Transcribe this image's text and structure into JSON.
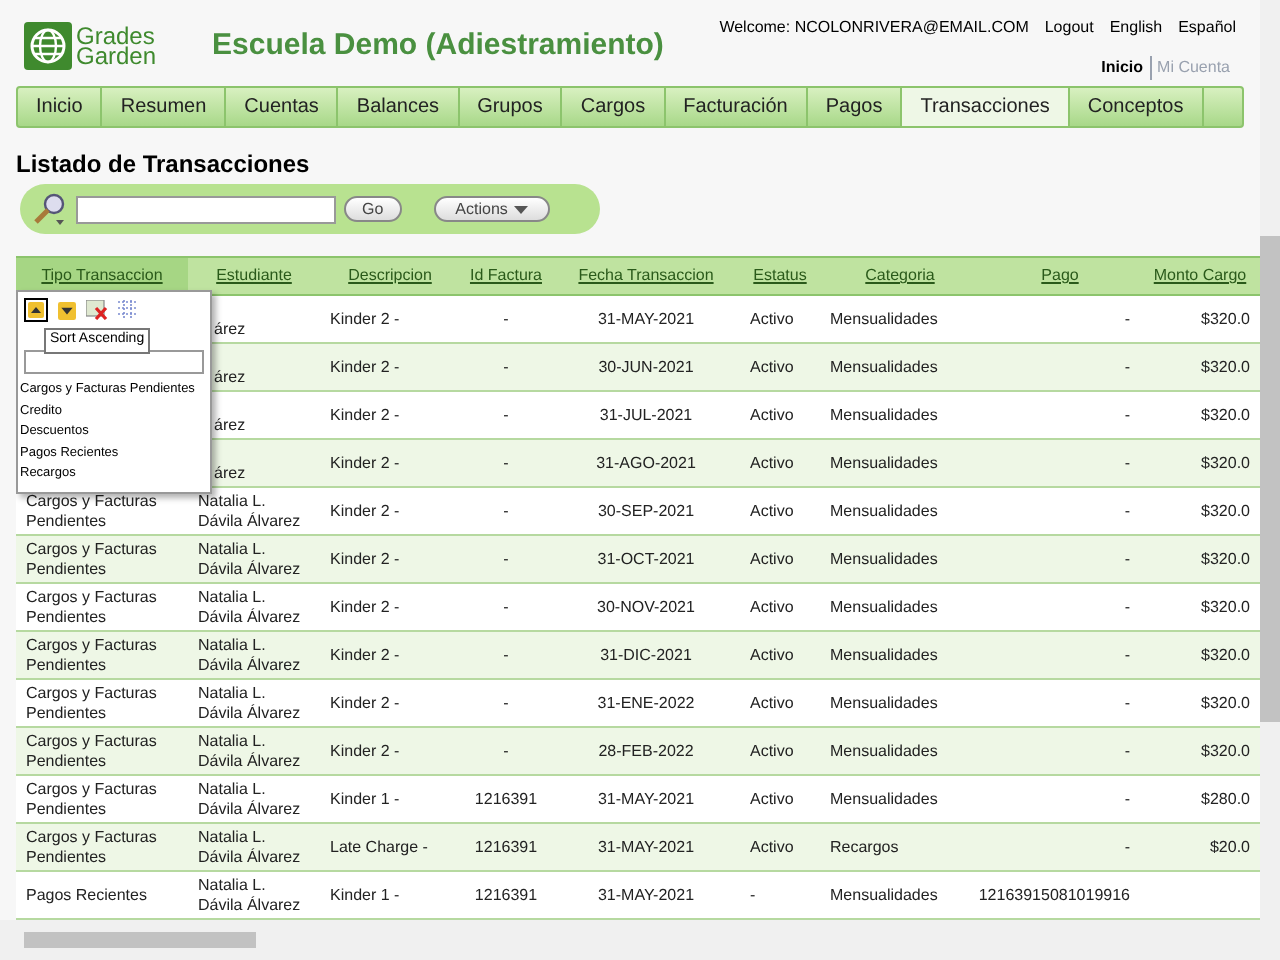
{
  "header": {
    "logo_line1": "Grades",
    "logo_line2": "Garden",
    "school": "Escuela Demo (Adiestramiento)",
    "welcome": "Welcome: NCOLONRIVERA@EMAIL.COM",
    "links": [
      "Logout",
      "English",
      "Español"
    ],
    "account_links": [
      {
        "label": "Inicio",
        "selected": true
      },
      {
        "label": "Mi Cuenta",
        "selected": false
      }
    ]
  },
  "tabs": [
    {
      "label": "Inicio",
      "selected": false
    },
    {
      "label": "Resumen",
      "selected": false
    },
    {
      "label": "Cuentas",
      "selected": false
    },
    {
      "label": "Balances",
      "selected": false
    },
    {
      "label": "Grupos",
      "selected": false
    },
    {
      "label": "Cargos",
      "selected": false
    },
    {
      "label": "Facturación",
      "selected": false
    },
    {
      "label": "Pagos",
      "selected": false
    },
    {
      "label": "Transacciones",
      "selected": true
    },
    {
      "label": "Conceptos",
      "selected": false
    }
  ],
  "page_title": "Listado de Transacciones",
  "search": {
    "go": "Go",
    "actions": "Actions"
  },
  "table": {
    "columns": [
      "Tipo Transaccion",
      "Estudiante",
      "Descripcion",
      "Id Factura",
      "Fecha Transaccion",
      "Estatus",
      "Categoria",
      "Pago",
      "Monto Cargo"
    ],
    "rows": [
      {
        "tipo": "",
        "estudiante": "árez",
        "descripcion": "Kinder 2 -",
        "id_factura": "-",
        "fecha": "31-MAY-2021",
        "estatus": "Activo",
        "categoria": "Mensualidades",
        "pago": "-",
        "monto": "$320.0"
      },
      {
        "tipo": "",
        "estudiante": "árez",
        "descripcion": "Kinder 2 -",
        "id_factura": "-",
        "fecha": "30-JUN-2021",
        "estatus": "Activo",
        "categoria": "Mensualidades",
        "pago": "-",
        "monto": "$320.0"
      },
      {
        "tipo": "",
        "estudiante": "árez",
        "descripcion": "Kinder 2 -",
        "id_factura": "-",
        "fecha": "31-JUL-2021",
        "estatus": "Activo",
        "categoria": "Mensualidades",
        "pago": "-",
        "monto": "$320.0"
      },
      {
        "tipo": "",
        "estudiante": "árez",
        "descripcion": "Kinder 2 -",
        "id_factura": "-",
        "fecha": "31-AGO-2021",
        "estatus": "Activo",
        "categoria": "Mensualidades",
        "pago": "-",
        "monto": "$320.0"
      },
      {
        "tipo": "Cargos y Facturas Pendientes",
        "estudiante": "Natalia L. Dávila Álvarez",
        "descripcion": "Kinder 2 -",
        "id_factura": "-",
        "fecha": "30-SEP-2021",
        "estatus": "Activo",
        "categoria": "Mensualidades",
        "pago": "-",
        "monto": "$320.0"
      },
      {
        "tipo": "Cargos y Facturas Pendientes",
        "estudiante": "Natalia L. Dávila Álvarez",
        "descripcion": "Kinder 2 -",
        "id_factura": "-",
        "fecha": "31-OCT-2021",
        "estatus": "Activo",
        "categoria": "Mensualidades",
        "pago": "-",
        "monto": "$320.0"
      },
      {
        "tipo": "Cargos y Facturas Pendientes",
        "estudiante": "Natalia L. Dávila Álvarez",
        "descripcion": "Kinder 2 -",
        "id_factura": "-",
        "fecha": "30-NOV-2021",
        "estatus": "Activo",
        "categoria": "Mensualidades",
        "pago": "-",
        "monto": "$320.0"
      },
      {
        "tipo": "Cargos y Facturas Pendientes",
        "estudiante": "Natalia L. Dávila Álvarez",
        "descripcion": "Kinder 2 -",
        "id_factura": "-",
        "fecha": "31-DIC-2021",
        "estatus": "Activo",
        "categoria": "Mensualidades",
        "pago": "-",
        "monto": "$320.0"
      },
      {
        "tipo": "Cargos y Facturas Pendientes",
        "estudiante": "Natalia L. Dávila Álvarez",
        "descripcion": "Kinder 2 -",
        "id_factura": "-",
        "fecha": "31-ENE-2022",
        "estatus": "Activo",
        "categoria": "Mensualidades",
        "pago": "-",
        "monto": "$320.0"
      },
      {
        "tipo": "Cargos y Facturas Pendientes",
        "estudiante": "Natalia L. Dávila Álvarez",
        "descripcion": "Kinder 2 -",
        "id_factura": "-",
        "fecha": "28-FEB-2022",
        "estatus": "Activo",
        "categoria": "Mensualidades",
        "pago": "-",
        "monto": "$320.0"
      },
      {
        "tipo": "Cargos y Facturas Pendientes",
        "estudiante": "Natalia L. Dávila Álvarez",
        "descripcion": "Kinder 1 -",
        "id_factura": "1216391",
        "fecha": "31-MAY-2021",
        "estatus": "Activo",
        "categoria": "Mensualidades",
        "pago": "-",
        "monto": "$280.0"
      },
      {
        "tipo": "Cargos y Facturas Pendientes",
        "estudiante": "Natalia L. Dávila Álvarez",
        "descripcion": "Late Charge -",
        "id_factura": "1216391",
        "fecha": "31-MAY-2021",
        "estatus": "Activo",
        "categoria": "Recargos",
        "pago": "-",
        "monto": "$20.0"
      },
      {
        "tipo": "Pagos Recientes",
        "estudiante": "Natalia L. Dávila Álvarez",
        "descripcion": "Kinder 1 -",
        "id_factura": "1216391",
        "fecha": "31-MAY-2021",
        "estatus": "-",
        "categoria": "Mensualidades",
        "pago": "12163915081019916",
        "monto": ""
      }
    ]
  },
  "column_menu": {
    "tooltip": "Sort Ascending",
    "sort_ascending_pressed": true,
    "values": [
      "Cargos y Facturas Pendientes",
      "Credito",
      "Descuentos",
      "Pagos Recientes",
      "Recargos"
    ]
  }
}
